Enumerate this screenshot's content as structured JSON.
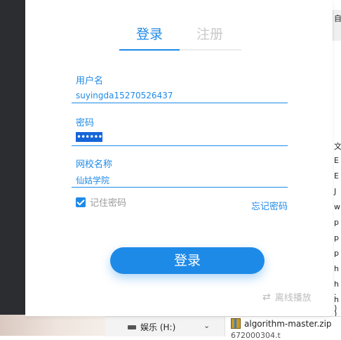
{
  "dialog": {
    "tabs": [
      {
        "label": "登录",
        "active": true
      },
      {
        "label": "注册",
        "active": false
      }
    ],
    "username": {
      "label": "用户名",
      "value": "suyingda15270526437"
    },
    "password": {
      "label": "密码",
      "masked_value": "••••••"
    },
    "school": {
      "label": "网校名称",
      "value": "仙姑学院"
    },
    "remember": {
      "label": "记住密码",
      "checked": true
    },
    "forgot_label": "忘记密码",
    "login_button": "登录",
    "offline": {
      "label": "离线播放",
      "icon": "swap-arrows-icon"
    },
    "accent_color": "#1e8ae8"
  },
  "background": {
    "drive_label": "娱乐 (H:)",
    "zip_file": "algorithm-master.zip",
    "partial_file": "672000304.t",
    "right_chars": [
      "自",
      "文",
      "E",
      "E",
      "J",
      "w",
      "p",
      "p",
      "p",
      "h",
      "h",
      ".",
      "h",
      ")",
      ")"
    ]
  }
}
